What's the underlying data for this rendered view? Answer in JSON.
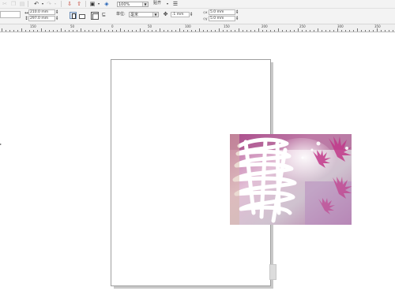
{
  "toolbar": {
    "zoom": "100%",
    "snap_label": "贴齐"
  },
  "property_bar": {
    "page_width": "210.0 mm",
    "page_height": "297.0 mm",
    "units_label": "单位:",
    "units_value": "毫米",
    "nudge_value": ".1 mm",
    "dup_x": "5.0 mm",
    "dup_y": "5.0 mm"
  },
  "ruler": {
    "labels": [
      "150",
      "50",
      "0",
      "50",
      "100",
      "150",
      "200",
      "250",
      "300",
      "350"
    ]
  },
  "colors": {
    "toolbar_bg": "#f3f3f3",
    "accent_blue": "#6e8fb8"
  }
}
